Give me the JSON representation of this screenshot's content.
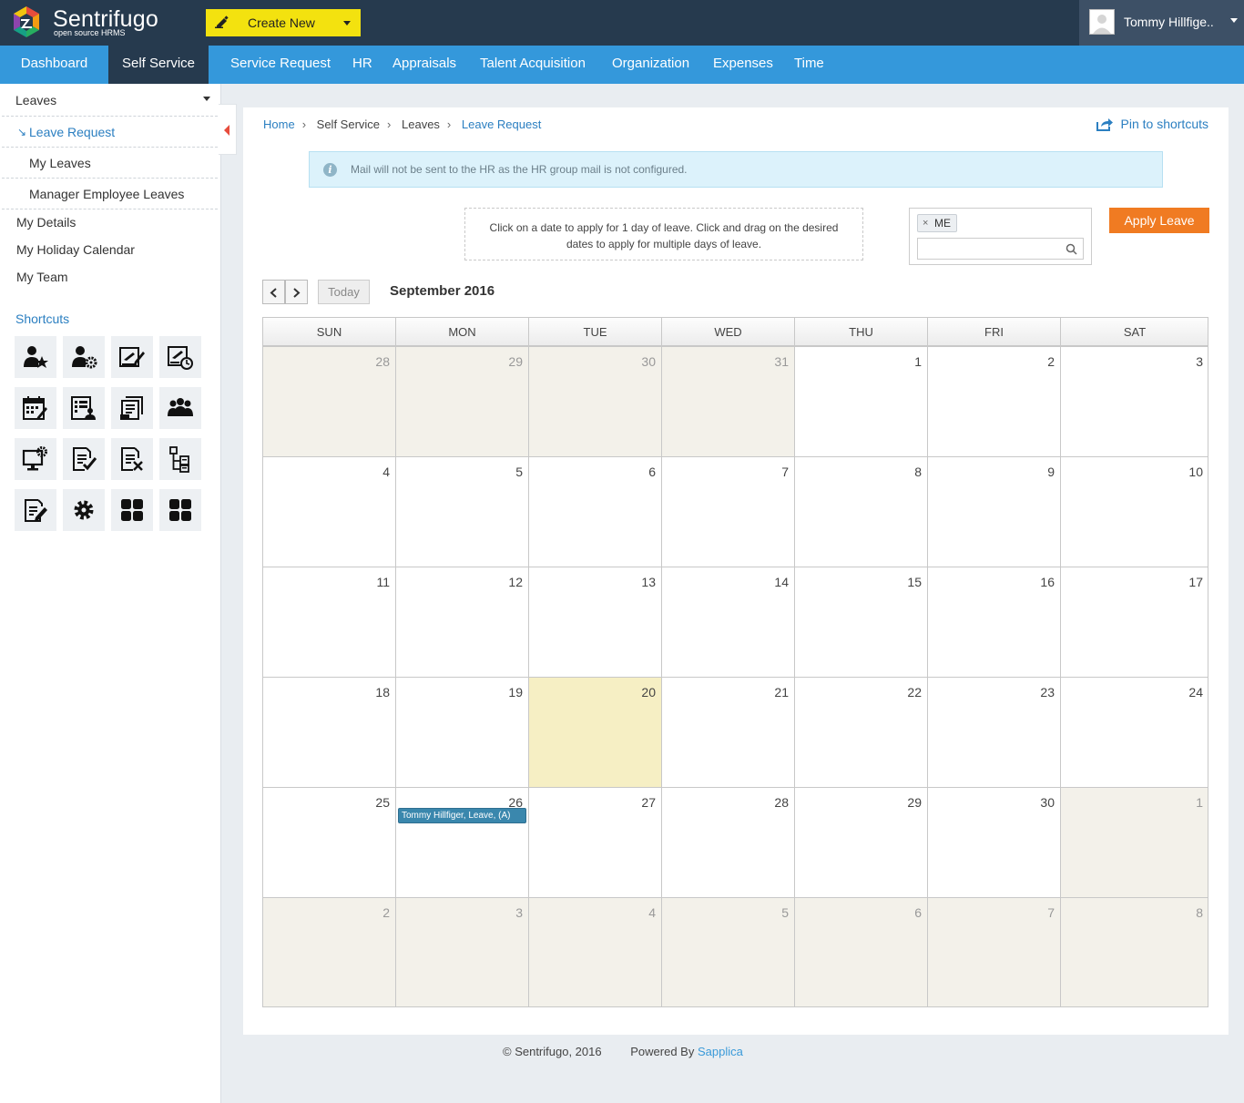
{
  "app": {
    "logo_name": "Sentrifugo",
    "logo_tagline": "open source HRMS",
    "create_new_label": "Create New",
    "user_name": "Tommy Hillfige.."
  },
  "nav": {
    "items": [
      "Dashboard",
      "Self Service",
      "Service Request",
      "HR",
      "Appraisals",
      "Talent Acquisition",
      "Organization",
      "Expenses",
      "Time"
    ],
    "active": "Self Service"
  },
  "sidebar": {
    "section": "Leaves",
    "sub_items": [
      "Leave Request",
      "My Leaves",
      "Manager Employee Leaves"
    ],
    "active_sub": "Leave Request",
    "links": [
      "My Details",
      "My Holiday Calendar",
      "My Team"
    ],
    "shortcuts_title": "Shortcuts",
    "shortcut_icons": [
      "user-star-icon",
      "user-gear-icon",
      "plane-edit-icon",
      "plane-clock-icon",
      "calendar-edit-icon",
      "list-user-icon",
      "document-user-icon",
      "team-icon",
      "monitor-gear-icon",
      "document-check-icon",
      "document-cross-icon",
      "tree-document-icon",
      "document-edit-icon",
      "gear-icon",
      "grid-icon",
      "grid-icon"
    ]
  },
  "breadcrumb": {
    "items": [
      "Home",
      "Self Service",
      "Leaves",
      "Leave Request"
    ]
  },
  "pin_label": "Pin to shortcuts",
  "alert_text": "Mail will not be sent to the HR as the HR group mail is not configured.",
  "hint_text": "Click on a date to apply for 1 day of leave. Click and drag on the desired dates to apply for multiple days of leave.",
  "selector": {
    "tag": "ME",
    "tag_remove": "×"
  },
  "apply_label": "Apply Leave",
  "calendar": {
    "today_label": "Today",
    "month_title": "September 2016",
    "weekdays": [
      "SUN",
      "MON",
      "TUE",
      "WED",
      "THU",
      "FRI",
      "SAT"
    ],
    "weeks": [
      [
        28,
        29,
        30,
        31,
        1,
        2,
        3
      ],
      [
        4,
        5,
        6,
        7,
        8,
        9,
        10
      ],
      [
        11,
        12,
        13,
        14,
        15,
        16,
        17
      ],
      [
        18,
        19,
        20,
        21,
        22,
        23,
        24
      ],
      [
        25,
        26,
        27,
        28,
        29,
        30,
        1
      ],
      [
        2,
        3,
        4,
        5,
        6,
        7,
        8
      ]
    ],
    "today_day": 20,
    "event": {
      "day": 26,
      "label": "Tommy Hillfiger, Leave, (A)",
      "color": "#3a87ad"
    }
  },
  "footer": {
    "copyright": "© Sentrifugo, 2016",
    "powered_prefix": "Powered By",
    "powered_link": "Sapplica"
  },
  "colors": {
    "topbar": "#263a4e",
    "nav": "#3498db",
    "create_new": "#f3e20f",
    "apply": "#f07b22",
    "today": "#f6efc4",
    "other_month": "#f3f1ea"
  }
}
